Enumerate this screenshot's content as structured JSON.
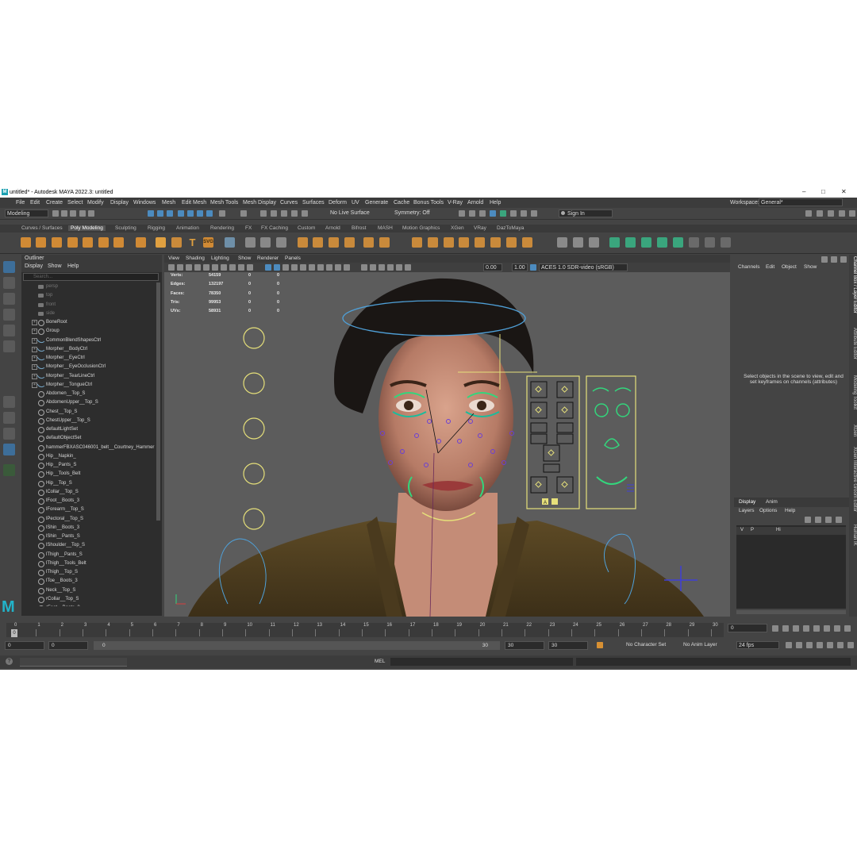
{
  "window": {
    "title": "untitled* - Autodesk MAYA 2022.3: untitled",
    "controls": [
      "–",
      "□",
      "✕"
    ]
  },
  "menubar": [
    "File",
    "Edit",
    "Create",
    "Select",
    "Modify",
    "Display",
    "Windows",
    "Mesh",
    "Edit Mesh",
    "Mesh Tools",
    "Mesh Display",
    "Curves",
    "Surfaces",
    "Deform",
    "UV",
    "Generate",
    "Cache",
    "Bonus Tools",
    "V-Ray",
    "Arnold",
    "Help"
  ],
  "workspace": {
    "label": "Workspace:",
    "value": "General*"
  },
  "statusline": {
    "menuset": "Modeling",
    "live_surface": "No Live Surface",
    "symmetry": "Symmetry: Off",
    "sign_in": "Sign In"
  },
  "shelf_tabs": [
    "Curves / Surfaces",
    "Poly Modeling",
    "Sculpting",
    "Rigging",
    "Animation",
    "Rendering",
    "FX",
    "FX Caching",
    "Custom",
    "Arnold",
    "Bifrost",
    "MASH",
    "Motion Graphics",
    "XGen",
    "VRay",
    "DazToMaya"
  ],
  "shelf_active": "Poly Modeling",
  "shelf_svg_label": "SVG",
  "outliner": {
    "title": "Outliner",
    "menu": [
      "Display",
      "Show",
      "Help"
    ],
    "search_placeholder": "Search...",
    "items": [
      {
        "name": "persp",
        "icon": "camera",
        "dim": true,
        "expand": ""
      },
      {
        "name": "top",
        "icon": "camera",
        "dim": true,
        "expand": ""
      },
      {
        "name": "front",
        "icon": "camera",
        "dim": true,
        "expand": ""
      },
      {
        "name": "side",
        "icon": "camera",
        "dim": true,
        "expand": ""
      },
      {
        "name": "BoneRoot",
        "icon": "joint",
        "dim": false,
        "expand": "+"
      },
      {
        "name": "Group",
        "icon": "group",
        "dim": false,
        "expand": "+"
      },
      {
        "name": "CommonBlendShapesCtrl",
        "icon": "curve",
        "dim": false,
        "expand": "+"
      },
      {
        "name": "Morpher__BodyCtrl",
        "icon": "curve",
        "dim": false,
        "expand": "+"
      },
      {
        "name": "Morpher__EyeCtrl",
        "icon": "curve",
        "dim": false,
        "expand": "+"
      },
      {
        "name": "Morpher__EyeOcclusionCtrl",
        "icon": "curve",
        "dim": false,
        "expand": "+"
      },
      {
        "name": "Morpher__TearLineCtrl",
        "icon": "curve",
        "dim": false,
        "expand": "+"
      },
      {
        "name": "Morpher__TongueCtrl",
        "icon": "curve",
        "dim": false,
        "expand": "+"
      },
      {
        "name": "Abdomen__Top_S",
        "icon": "set",
        "dim": false,
        "expand": ""
      },
      {
        "name": "AbdomenUpper__Top_S",
        "icon": "set",
        "dim": false,
        "expand": ""
      },
      {
        "name": "Chest__Top_S",
        "icon": "set",
        "dim": false,
        "expand": ""
      },
      {
        "name": "ChestUpper__Top_S",
        "icon": "set",
        "dim": false,
        "expand": ""
      },
      {
        "name": "defaultLightSet",
        "icon": "set",
        "dim": false,
        "expand": ""
      },
      {
        "name": "defaultObjectSet",
        "icon": "set",
        "dim": false,
        "expand": ""
      },
      {
        "name": "hammerFBXASC046001_belt__Courtney_Hammer",
        "icon": "set",
        "dim": false,
        "expand": ""
      },
      {
        "name": "Hip__Napkin_",
        "icon": "set",
        "dim": false,
        "expand": ""
      },
      {
        "name": "Hip__Pants_S",
        "icon": "set",
        "dim": false,
        "expand": ""
      },
      {
        "name": "Hip__Tools_Belt",
        "icon": "set",
        "dim": false,
        "expand": ""
      },
      {
        "name": "Hip__Top_S",
        "icon": "set",
        "dim": false,
        "expand": ""
      },
      {
        "name": "lCollar__Top_S",
        "icon": "set",
        "dim": false,
        "expand": ""
      },
      {
        "name": "lFoot__Boots_3",
        "icon": "set",
        "dim": false,
        "expand": ""
      },
      {
        "name": "lForearm__Top_S",
        "icon": "set",
        "dim": false,
        "expand": ""
      },
      {
        "name": "lPectoral__Top_S",
        "icon": "set",
        "dim": false,
        "expand": ""
      },
      {
        "name": "lShin__Boots_3",
        "icon": "set",
        "dim": false,
        "expand": ""
      },
      {
        "name": "lShin__Pants_S",
        "icon": "set",
        "dim": false,
        "expand": ""
      },
      {
        "name": "lShoulder__Top_S",
        "icon": "set",
        "dim": false,
        "expand": ""
      },
      {
        "name": "lThigh__Pants_S",
        "icon": "set",
        "dim": false,
        "expand": ""
      },
      {
        "name": "lThigh__Tools_Belt",
        "icon": "set",
        "dim": false,
        "expand": ""
      },
      {
        "name": "lThigh__Top_S",
        "icon": "set",
        "dim": false,
        "expand": ""
      },
      {
        "name": "lToe__Boots_3",
        "icon": "set",
        "dim": false,
        "expand": ""
      },
      {
        "name": "Neck__Top_S",
        "icon": "set",
        "dim": false,
        "expand": ""
      },
      {
        "name": "rCollar__Top_S",
        "icon": "set",
        "dim": false,
        "expand": ""
      },
      {
        "name": "rFoot__Boots_3",
        "icon": "set",
        "dim": false,
        "expand": ""
      }
    ]
  },
  "viewport": {
    "menu": [
      "View",
      "Shading",
      "Lighting",
      "Show",
      "Renderer",
      "Panels"
    ],
    "exposure": "0.00",
    "gamma": "1.00",
    "color_space": "ACES 1.0 SDR-video (sRGB)",
    "hud": [
      {
        "label": "Verts:",
        "v1": "54159",
        "v2": "0",
        "v3": "0"
      },
      {
        "label": "Edges:",
        "v1": "132197",
        "v2": "0",
        "v3": "0"
      },
      {
        "label": "Faces:",
        "v1": "78350",
        "v2": "0",
        "v3": "0"
      },
      {
        "label": "Tris:",
        "v1": "99953",
        "v2": "0",
        "v3": "0"
      },
      {
        "label": "UVs:",
        "v1": "58931",
        "v2": "0",
        "v3": "0"
      }
    ],
    "panel_button": "A"
  },
  "channel_box": {
    "menu": [
      "Channels",
      "Edit",
      "Object",
      "Show"
    ],
    "message": "Select objects in the scene to view, edit and set keyframes on channels (attributes)"
  },
  "layer_editor": {
    "tabs": [
      "Display",
      "Anim"
    ],
    "active_tab": "Display",
    "menu": [
      "Layers",
      "Options",
      "Help"
    ],
    "row": {
      "v": "V",
      "p": "P",
      "name": "Hi"
    }
  },
  "side_tabs": [
    "Channel Box / Layer Editor",
    "Attribute Editor",
    "Modeling Toolkit",
    "XGen",
    "XGen Interactive Groom Editor",
    "Human IK"
  ],
  "timeslider": {
    "ticks": [
      "0",
      "1",
      "2",
      "3",
      "4",
      "5",
      "6",
      "7",
      "8",
      "9",
      "10",
      "11",
      "12",
      "13",
      "14",
      "15",
      "16",
      "17",
      "18",
      "19",
      "20",
      "21",
      "22",
      "23",
      "24",
      "25",
      "26",
      "27",
      "28",
      "29",
      "30"
    ],
    "current_frame": "0",
    "current_field": "0"
  },
  "range": {
    "start": "0",
    "playback_start": "0",
    "slider_start": "0",
    "slider_end": "30",
    "playback_end": "30",
    "end": "30",
    "character_set": "No Character Set",
    "anim_layer": "No Anim Layer",
    "fps": "24 fps"
  },
  "commandline": {
    "lang": "MEL",
    "help": "?"
  },
  "colors": {
    "accent_blue": "#4c8bbf",
    "maya_teal": "#22b3c9",
    "rig_yellow": "#e6e07a",
    "rig_green": "#33d67c"
  }
}
